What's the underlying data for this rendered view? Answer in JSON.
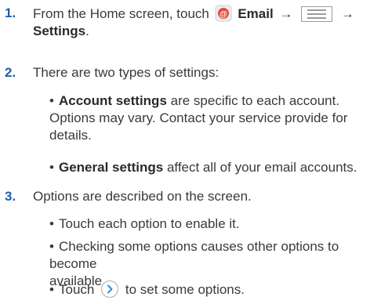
{
  "steps": [
    {
      "number": "1.",
      "prefix": "From the Home screen, touch",
      "email_label": "Email",
      "arrow": "→",
      "settings_label": "Settings",
      "suffix": "."
    },
    {
      "number": "2.",
      "text": "There are two types of settings:",
      "bullets": [
        {
          "bold": "Account settings",
          "line1": " are specific to each account.",
          "line2": "Options may vary. Contact your service provide for",
          "line3": "details."
        },
        {
          "bold": "General settings",
          "line1": " affect all of your email accounts."
        }
      ]
    },
    {
      "number": "3.",
      "text": "Options are described on the screen.",
      "bullets": [
        {
          "line1": "Touch each option to enable it."
        },
        {
          "line1": "Checking some options causes other options to become",
          "line2": "available."
        },
        {
          "prefix": "Touch",
          "suffix": "to set some options."
        }
      ]
    }
  ],
  "bullet_char": "•",
  "icons": {
    "email": "email-app-icon",
    "menu": "menu-icon",
    "next": "chevron-right-circle-icon"
  },
  "colors": {
    "step_number": "#1a5fa8",
    "text": "#3a3a3a"
  }
}
